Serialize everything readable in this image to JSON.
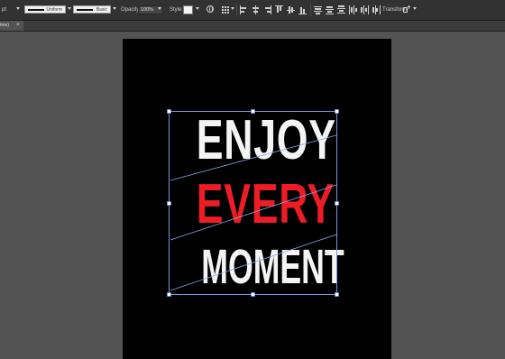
{
  "control_bar": {
    "unit_fragment": "pt",
    "stroke_profile": "Uniform",
    "brush_definition": "Basic",
    "opacity_label": "Opacity:",
    "opacity_value": "100%",
    "style_label": "Style:",
    "transform_label": "Transform"
  },
  "tab_bar": {
    "doc_tab_label": "iew)",
    "close_glyph": "×"
  },
  "artwork": {
    "line1": "ENJOY",
    "line2": "EVERY",
    "line3": "MOMENT",
    "colors": {
      "white": "#f4f4f4",
      "red": "#ee1c25",
      "artboard": "#000000",
      "canvas": "#535353",
      "selection": "#6b8cd6"
    }
  }
}
